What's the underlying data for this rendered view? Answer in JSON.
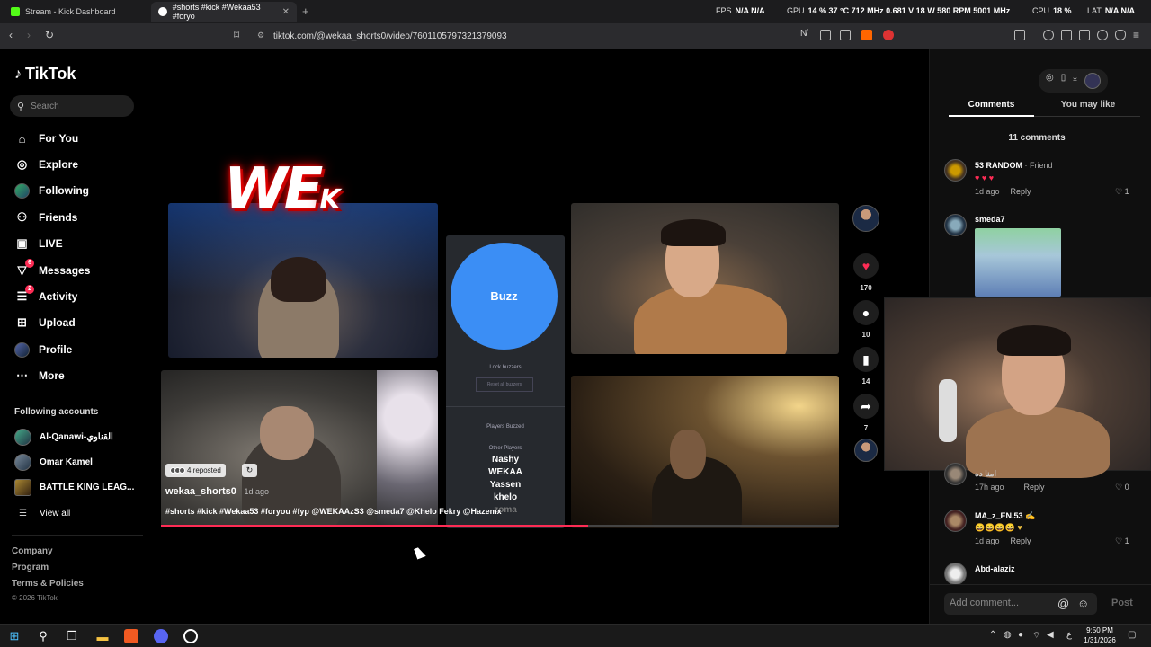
{
  "browser": {
    "tabs": [
      {
        "title": "Stream - Kick Dashboard"
      },
      {
        "title": "#shorts #kick #Wekaa53 #foryo"
      }
    ],
    "url": "tiktok.com/@wekaa_shorts0/video/7601105797321379093"
  },
  "hud": {
    "fps_label": "FPS",
    "fps": "N/A  N/A",
    "gpu_label": "GPU",
    "gpu": "14 % 37 °C 712 MHz 0.681 V 18 W 580 RPM 5001 MHz",
    "cpu_label": "CPU",
    "cpu": "18 %",
    "lat_label": "LAT",
    "lat": "N/A N/A"
  },
  "sidebar": {
    "logo": "TikTok",
    "search_placeholder": "Search",
    "nav": [
      {
        "label": "For You",
        "icon": "home-icon"
      },
      {
        "label": "Explore",
        "icon": "compass-icon"
      },
      {
        "label": "Following",
        "icon": "avatar"
      },
      {
        "label": "Friends",
        "icon": "friends-icon"
      },
      {
        "label": "LIVE",
        "icon": "live-icon"
      },
      {
        "label": "Messages",
        "icon": "messages-icon",
        "badge": "6"
      },
      {
        "label": "Activity",
        "icon": "activity-icon",
        "badge": "2"
      },
      {
        "label": "Upload",
        "icon": "upload-icon"
      },
      {
        "label": "Profile",
        "icon": "avatar"
      },
      {
        "label": "More",
        "icon": "more-icon"
      }
    ],
    "following_title": "Following accounts",
    "accounts": [
      {
        "name": "Al-Qanawi-القناوي"
      },
      {
        "name": "Omar Kamel"
      },
      {
        "name": "BATTLE KING LEAG..."
      }
    ],
    "view_all": "View all",
    "footer": [
      "Company",
      "Program",
      "Terms & Policies"
    ],
    "copyright": "© 2026 TikTok"
  },
  "video": {
    "overlay_logo": "WE",
    "overlay_logo_small": "K",
    "buzz_label": "Buzz",
    "lock_buzzers": "Lock buzzers",
    "reset_buzzers": "Reset all buzzers",
    "players_buzzed": "Players Buzzed",
    "other_players": "Other Players",
    "players": [
      "Nashy",
      "WEKAA",
      "Yassen",
      "khelo",
      "zoma"
    ],
    "reposted": "4 reposted",
    "author": "wekaa_shorts0",
    "ago": "· 1d ago",
    "caption": "#shorts #kick #Wekaa53 #foryou #fyp @WEKAAzS3 @smeda7 @Khelo Fekry @Hazemx",
    "progress": 0.63
  },
  "actions": {
    "likes": "170",
    "comments": "10",
    "saves": "14",
    "shares": "7"
  },
  "comments_panel": {
    "tab_comments": "Comments",
    "tab_you_may_like": "You may like",
    "count": "11 comments",
    "items": [
      {
        "user": "53 RANDOM",
        "tag": " · Friend",
        "text": "♥ ♥ ♥",
        "ago": "1d ago",
        "reply": "Reply",
        "likes": "1"
      },
      {
        "user": "smeda7"
      },
      {
        "user": "امنا ده",
        "ago": "17h ago",
        "reply": "Reply",
        "likes": "0"
      },
      {
        "user": "MA_z_EN.53 ✍",
        "text": "😀😀😀😀 ♥",
        "ago": "1d ago",
        "reply": "Reply",
        "likes": "1"
      },
      {
        "user": "Abd-alaziz"
      }
    ],
    "add_placeholder": "Add comment...",
    "post": "Post"
  },
  "taskbar": {
    "time": "9:50 PM",
    "date": "1/31/2026"
  },
  "colors": {
    "accent": "#fe2c55",
    "buzz": "#3b8ef5"
  }
}
